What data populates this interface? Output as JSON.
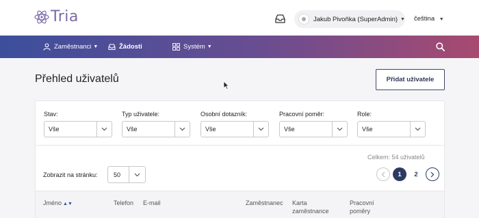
{
  "app": {
    "logo_text": "Tria"
  },
  "header": {
    "user_name": "Jakub Pivoňka (SuperAdmin)",
    "language": "čeština"
  },
  "nav": {
    "items": [
      {
        "label": "Zaměstnanci",
        "icon": "person-icon"
      },
      {
        "label": "Žádosti",
        "icon": "inbox-icon",
        "active": true
      },
      {
        "label": "Systém",
        "icon": "grid-icon"
      }
    ]
  },
  "page": {
    "title": "Přehled uživatelů",
    "add_button": "Přidat uživatele"
  },
  "filters": [
    {
      "label": "Stav:",
      "value": "Vše"
    },
    {
      "label": "Typ uživatele:",
      "value": "Vše"
    },
    {
      "label": "Osobní dotazník:",
      "value": "Vše"
    },
    {
      "label": "Pracovní poměr:",
      "value": "Vše"
    },
    {
      "label": "Role:",
      "value": "Vše"
    }
  ],
  "list": {
    "total": "Celkem: 54 uživatelů",
    "per_page_label": "Zobrazit na stránku:",
    "per_page_value": "50",
    "pages": [
      "1",
      "2"
    ],
    "current_page": "1"
  },
  "table": {
    "columns": [
      "Jméno",
      "Telefon",
      "E-mail",
      "Zaměstnanec",
      "Karta zaměstnance",
      "Pracovní poměry"
    ]
  },
  "colors": {
    "nav_gradient_start": "#3c4f9c",
    "nav_gradient_end": "#a84a70",
    "accent": "#2d3a63"
  }
}
